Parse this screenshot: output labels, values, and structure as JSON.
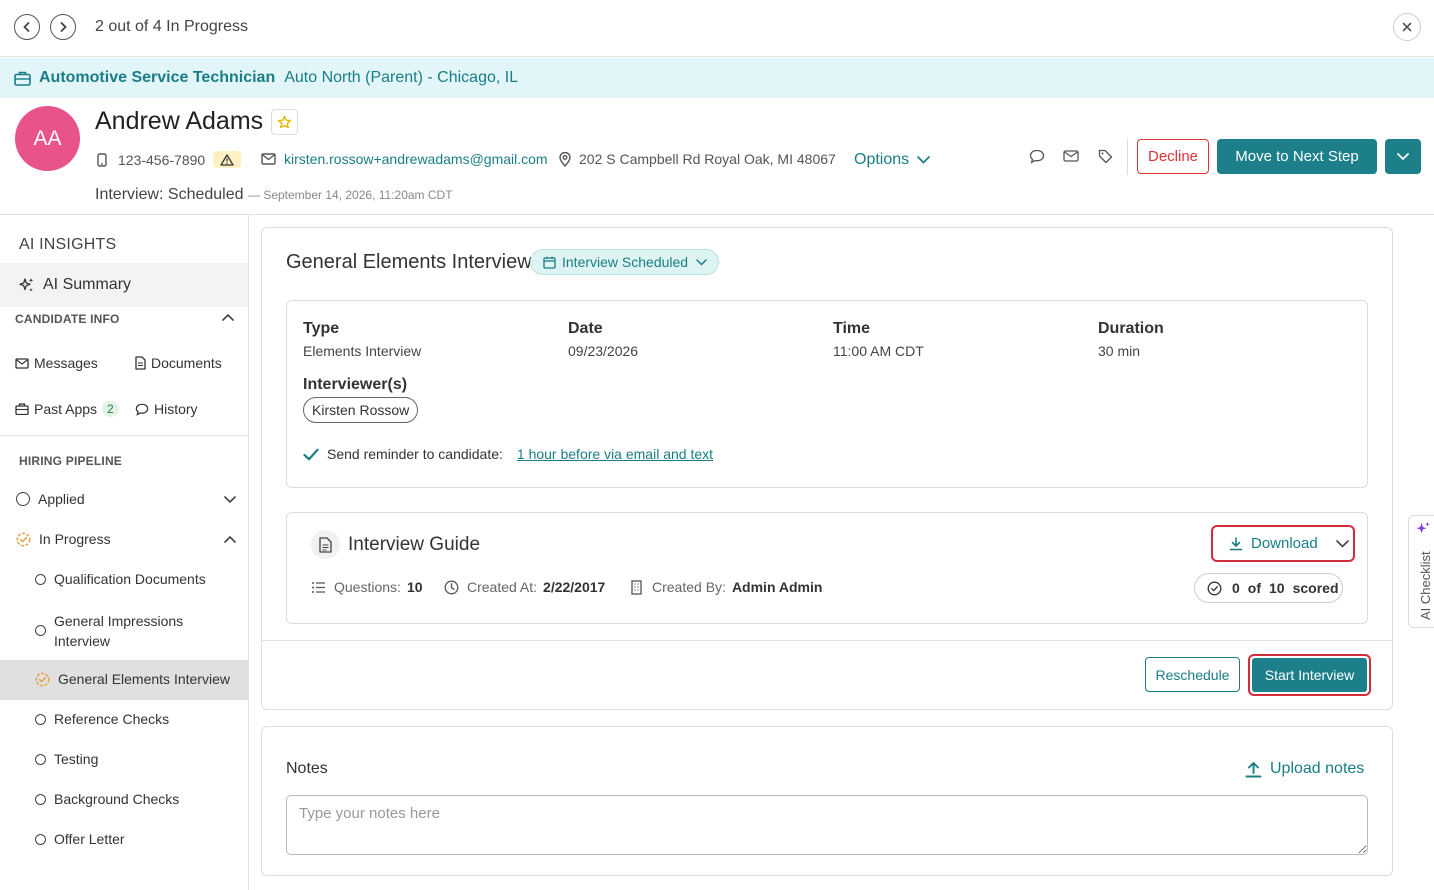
{
  "nav": {
    "progress_text": "2 out of 4 In Progress"
  },
  "job": {
    "title": "Automotive Service Technician",
    "location": "Auto North (Parent) - Chicago, IL"
  },
  "candidate": {
    "initials": "AA",
    "name": "Andrew Adams",
    "phone": "123-456-7890",
    "email": "kirsten.rossow+andrewadams@gmail.com",
    "address": "202 S Campbell Rd Royal Oak, MI 48067",
    "options_label": "Options",
    "status": "Interview: Scheduled",
    "status_date": "— September 14, 2026, 11:20am CDT",
    "avatar_color": "#e7538a"
  },
  "actions": {
    "decline": "Decline",
    "next_step": "Move to Next Step"
  },
  "sidebar": {
    "ai_insights_title": "AI INSIGHTS",
    "ai_summary": "AI Summary",
    "candidate_info_title": "CANDIDATE INFO",
    "messages": "Messages",
    "documents": "Documents",
    "past_apps": "Past Apps",
    "past_apps_count": "2",
    "history": "History",
    "hiring_pipeline_title": "HIRING PIPELINE",
    "applied": "Applied",
    "in_progress": "In Progress",
    "steps": [
      {
        "label": "Qualification Documents"
      },
      {
        "label": "General Impressions Interview"
      },
      {
        "label": "General Elements Interview"
      },
      {
        "label": "Reference Checks"
      },
      {
        "label": "Testing"
      },
      {
        "label": "Background Checks"
      },
      {
        "label": "Offer Letter"
      }
    ]
  },
  "interview": {
    "title": "General Elements Interview",
    "status_chip": "Interview Scheduled",
    "type_label": "Type",
    "type_value": "Elements Interview",
    "date_label": "Date",
    "date_value": "09/23/2026",
    "time_label": "Time",
    "time_value": "11:00 AM CDT",
    "duration_label": "Duration",
    "duration_value": "30 min",
    "interviewers_label": "Interviewer(s)",
    "interviewer": "Kirsten Rossow",
    "reminder_label": "Send reminder to candidate:",
    "reminder_link": "1 hour before via email and text",
    "reminder_checked": true
  },
  "guide": {
    "title": "Interview Guide",
    "download": "Download",
    "questions_label": "Questions:",
    "questions_value": "10",
    "created_at_label": "Created At:",
    "created_at_value": "2/22/2017",
    "created_by_label": "Created By:",
    "created_by_value": "Admin Admin",
    "scored_count": "0",
    "scored_of": "of",
    "scored_total": "10",
    "scored_label": "scored"
  },
  "footer_actions": {
    "reschedule": "Reschedule",
    "start": "Start Interview"
  },
  "notes": {
    "title": "Notes",
    "upload": "Upload notes",
    "placeholder": "Type your notes here"
  },
  "ai_checklist": {
    "label": "AI Checklist"
  },
  "colors": {
    "brand_teal": "#1c7f89",
    "banner_bg": "#e2f6f9",
    "decline_red": "#dd3333",
    "highlight_red": "#d22d3a"
  }
}
